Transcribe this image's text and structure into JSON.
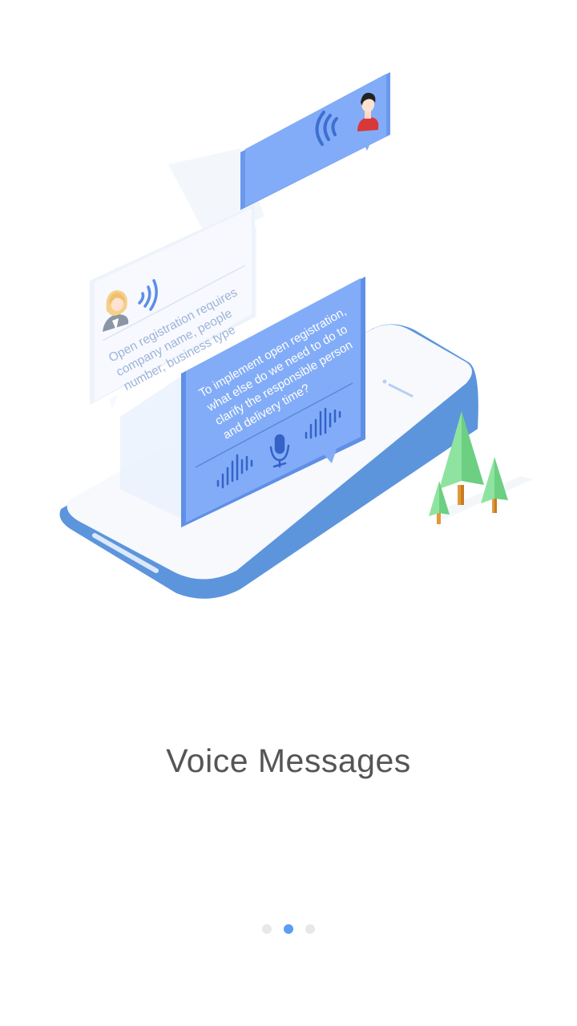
{
  "onboarding": {
    "title": "Voice Messages",
    "current_page": 2,
    "page_count": 3
  },
  "illustration": {
    "gray_bubble_lines": [
      "Open registration requires",
      "company name, people",
      "number, business type"
    ],
    "blue_bubble_lines": [
      "To implement open registration,",
      "what else do we need to do to",
      "clarify the responsible person",
      "and delivery time?"
    ]
  },
  "colors": {
    "accent": "#5b9df0",
    "bubble_blue": "#7ea9f7",
    "phone_edge": "#5c95dc",
    "tree_green": "#7ed992"
  }
}
